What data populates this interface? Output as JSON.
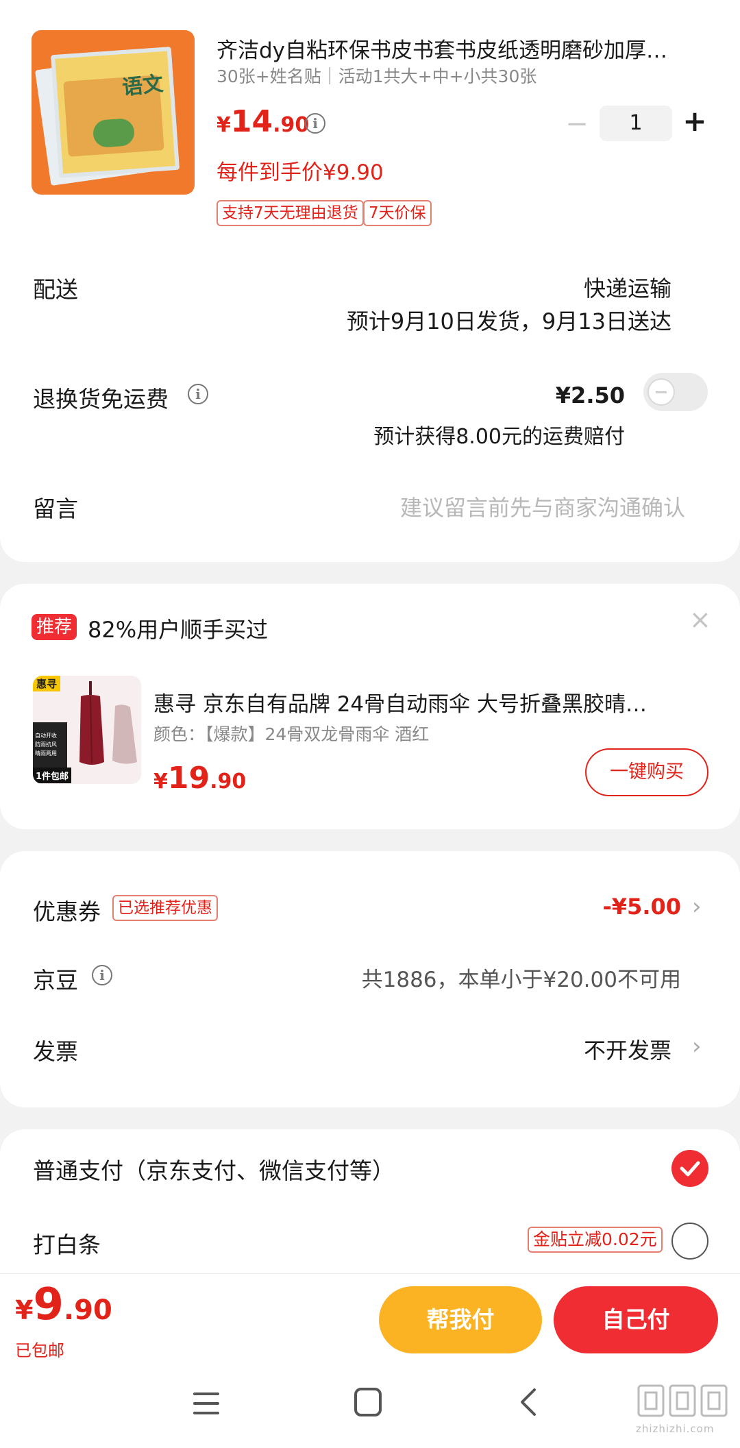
{
  "product": {
    "title": "齐洁dy自粘环保书皮书套书皮纸透明磨砂加厚…",
    "spec": "30张+姓名贴｜活动1共大+中+小共30张",
    "price_symbol": "¥",
    "price_int": "14",
    "price_dec": ".90",
    "final_price": "每件到手价¥9.90",
    "quantity": "1",
    "qty_minus": "−",
    "qty_plus": "+",
    "tags": [
      "支持7天无理由退货",
      "7天价保"
    ],
    "thumb_text": "语文"
  },
  "delivery": {
    "label": "配送",
    "method": "快递运输",
    "eta": "预计9月10日发货，9月13日送达"
  },
  "return_shipping": {
    "label": "退换货免运费",
    "price": "¥2.50",
    "note": "预计获得8.00元的运费赔付",
    "enabled": false
  },
  "message": {
    "label": "留言",
    "placeholder": "建议留言前先与商家沟通确认"
  },
  "recommend": {
    "badge": "推荐",
    "headline": "82%用户顺手买过",
    "close": "×",
    "product_title": "惠寻 京东自有品牌 24骨自动雨伞 大号折叠黑胶晴…",
    "product_spec": "颜色：【爆款】24骨双龙骨雨伞 酒红",
    "price_symbol": "¥",
    "price_int": "19",
    "price_dec": ".90",
    "buy_button": "一键购买",
    "thumb_badge": "惠寻",
    "thumb_free": "1件包邮",
    "thumb_features": [
      "自动开收",
      "防雨抗风",
      "晴雨两用"
    ]
  },
  "discounts": {
    "coupon_label": "优惠券",
    "coupon_tag": "已选推荐优惠",
    "coupon_value": "-¥5.00",
    "beans_label": "京豆",
    "beans_value": "共1886，本单小于¥20.00不可用",
    "invoice_label": "发票",
    "invoice_value": "不开发票"
  },
  "payment": {
    "normal_label": "普通支付（京东支付、微信支付等）",
    "normal_selected": true,
    "baitiao_label": "打白条",
    "baitiao_tag": "金贴立减0.02元",
    "baitiao_selected": false
  },
  "footer": {
    "price_symbol": "¥",
    "price_int": "9",
    "price_dec": ".90",
    "shipping": "已包邮",
    "help_pay": "帮我付",
    "self_pay": "自己付"
  },
  "watermark": {
    "text": "zhizhizhi.com"
  },
  "colors": {
    "accent": "#e2231a",
    "help_pay": "#fbb324",
    "self_pay": "#ef2d33"
  }
}
